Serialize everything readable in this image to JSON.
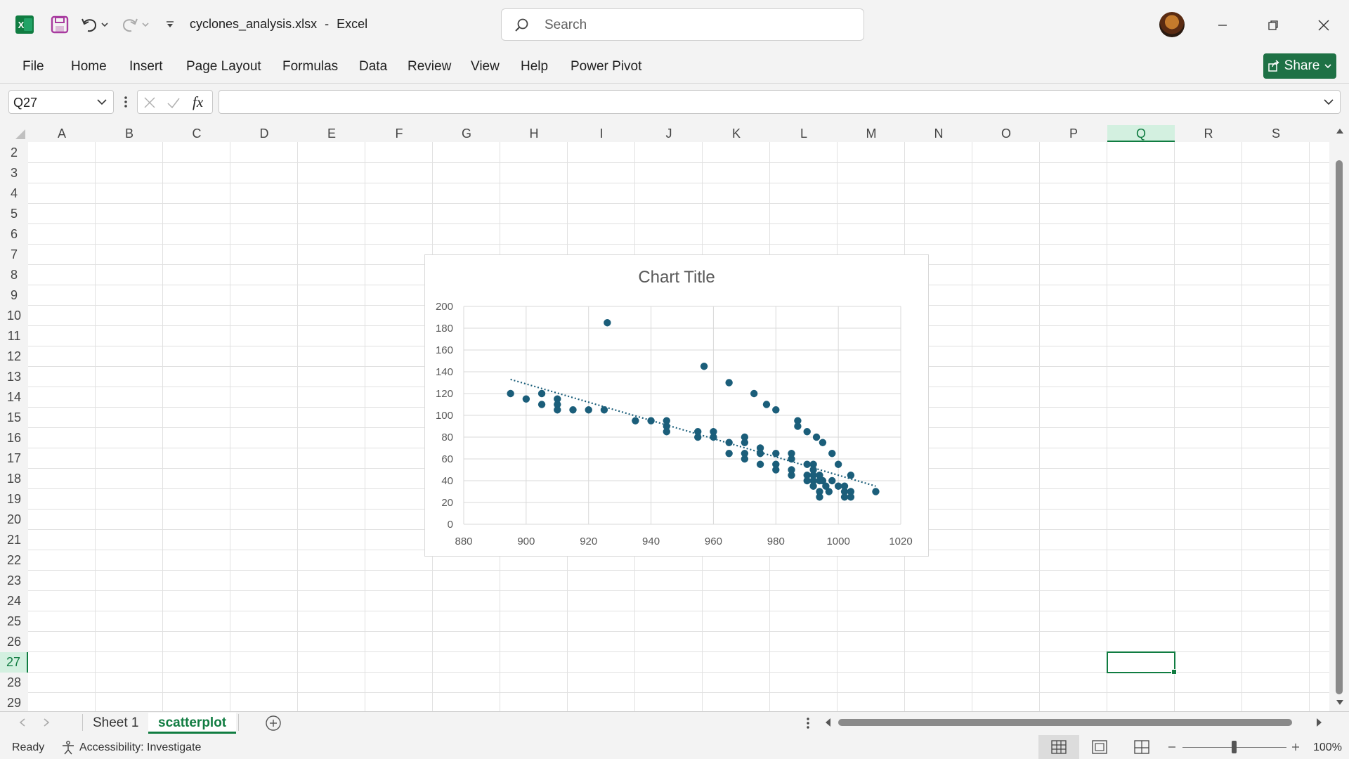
{
  "window": {
    "file_name": "cyclones_analysis.xlsx",
    "separator": "-",
    "app_name": "Excel",
    "search_placeholder": "Search"
  },
  "menu": {
    "items": [
      "File",
      "Home",
      "Insert",
      "Page Layout",
      "Formulas",
      "Data",
      "Review",
      "View",
      "Help",
      "Power Pivot"
    ],
    "share_label": "Share"
  },
  "formula_bar": {
    "name_box": "Q27",
    "fx_label": "fx",
    "formula": ""
  },
  "grid": {
    "columns": [
      "A",
      "B",
      "C",
      "D",
      "E",
      "F",
      "G",
      "H",
      "I",
      "J",
      "K",
      "L",
      "M",
      "N",
      "O",
      "P",
      "Q",
      "R",
      "S"
    ],
    "rows": [
      "2",
      "3",
      "4",
      "5",
      "6",
      "7",
      "8",
      "9",
      "10",
      "11",
      "12",
      "13",
      "14",
      "15",
      "16",
      "17",
      "18",
      "19",
      "20",
      "21",
      "22",
      "23",
      "24",
      "25",
      "26",
      "27",
      "28",
      "29"
    ],
    "selected_column": "Q",
    "selected_row": "27",
    "selected_cell": "Q27"
  },
  "chart_data": {
    "type": "scatter",
    "title": "Chart Title",
    "xlabel": "",
    "ylabel": "",
    "xlim": [
      880,
      1020
    ],
    "ylim": [
      0,
      200
    ],
    "x_ticks": [
      "880",
      "900",
      "920",
      "940",
      "960",
      "980",
      "1000",
      "1020"
    ],
    "y_ticks": [
      "0",
      "20",
      "40",
      "60",
      "80",
      "100",
      "120",
      "140",
      "160",
      "180",
      "200"
    ],
    "grid": true,
    "trendline": {
      "type": "linear",
      "style": "dotted",
      "x": [
        895,
        1012
      ],
      "y": [
        133,
        35
      ]
    },
    "marker_color": "#1b5e7a",
    "points": [
      [
        895,
        120
      ],
      [
        900,
        115
      ],
      [
        905,
        120
      ],
      [
        905,
        110
      ],
      [
        910,
        115
      ],
      [
        910,
        110
      ],
      [
        910,
        105
      ],
      [
        915,
        105
      ],
      [
        920,
        105
      ],
      [
        925,
        105
      ],
      [
        926,
        185
      ],
      [
        935,
        95
      ],
      [
        940,
        95
      ],
      [
        945,
        95
      ],
      [
        945,
        90
      ],
      [
        945,
        85
      ],
      [
        955,
        85
      ],
      [
        955,
        80
      ],
      [
        957,
        145
      ],
      [
        960,
        85
      ],
      [
        960,
        80
      ],
      [
        965,
        130
      ],
      [
        965,
        75
      ],
      [
        965,
        65
      ],
      [
        970,
        80
      ],
      [
        970,
        75
      ],
      [
        970,
        65
      ],
      [
        970,
        60
      ],
      [
        973,
        120
      ],
      [
        975,
        70
      ],
      [
        975,
        65
      ],
      [
        975,
        55
      ],
      [
        977,
        110
      ],
      [
        980,
        105
      ],
      [
        980,
        65
      ],
      [
        980,
        55
      ],
      [
        980,
        50
      ],
      [
        985,
        65
      ],
      [
        985,
        60
      ],
      [
        985,
        50
      ],
      [
        985,
        45
      ],
      [
        987,
        95
      ],
      [
        987,
        90
      ],
      [
        990,
        85
      ],
      [
        990,
        55
      ],
      [
        990,
        45
      ],
      [
        990,
        40
      ],
      [
        992,
        55
      ],
      [
        992,
        50
      ],
      [
        992,
        45
      ],
      [
        992,
        40
      ],
      [
        992,
        35
      ],
      [
        993,
        80
      ],
      [
        994,
        45
      ],
      [
        994,
        40
      ],
      [
        994,
        30
      ],
      [
        994,
        25
      ],
      [
        995,
        75
      ],
      [
        995,
        40
      ],
      [
        996,
        35
      ],
      [
        997,
        30
      ],
      [
        998,
        65
      ],
      [
        998,
        40
      ],
      [
        1000,
        55
      ],
      [
        1000,
        35
      ],
      [
        1002,
        35
      ],
      [
        1002,
        30
      ],
      [
        1002,
        25
      ],
      [
        1004,
        45
      ],
      [
        1004,
        30
      ],
      [
        1004,
        25
      ],
      [
        1012,
        30
      ]
    ]
  },
  "sheets": {
    "tabs": [
      "Sheet 1",
      "scatterplot"
    ],
    "active": "scatterplot"
  },
  "status": {
    "ready": "Ready",
    "accessibility": "Accessibility: Investigate",
    "zoom": "100%"
  },
  "colors": {
    "excel_green": "#1e7145",
    "active_tab_green": "#107c41",
    "chart_marker": "#1b5e7a"
  }
}
